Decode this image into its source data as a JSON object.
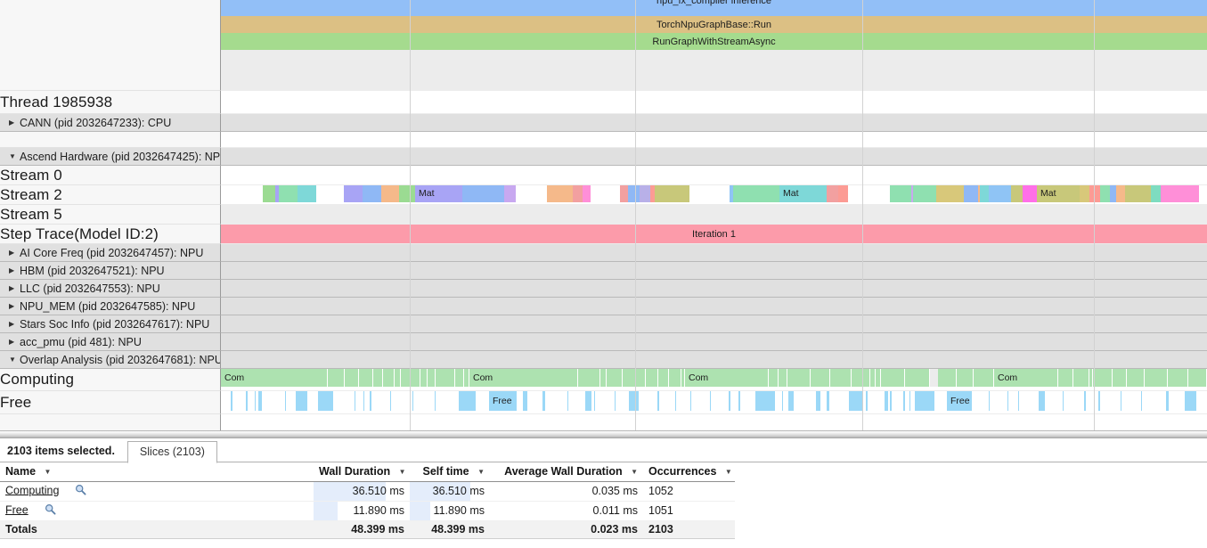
{
  "timeline": {
    "async_slices": [
      {
        "label": "npu_fx_compiler inference",
        "color": "#92BFF7",
        "textcolor": "#1d1d1d"
      },
      {
        "label": "TorchNpuGraphBase::Run",
        "color": "#DCC084",
        "textcolor": "#1d1d1d"
      },
      {
        "label": "RunGraphWithStreamAsync",
        "color": "#A5DB8E",
        "textcolor": "#1d1d1d"
      }
    ],
    "thread_label": "Thread 1985938",
    "groups": {
      "cann": "CANN (pid 2032647233): CPU",
      "ascend": "Ascend Hardware (pid 2032647425): NPU",
      "aicore": "AI Core Freq (pid 2032647457): NPU",
      "hbm": "HBM (pid 2032647521): NPU",
      "llc": "LLC (pid 2032647553): NPU",
      "npumem": "NPU_MEM (pid 2032647585): NPU",
      "stars": "Stars Soc Info (pid 2032647617): NPU",
      "accpmu": "acc_pmu (pid 481): NPU",
      "overlap": "Overlap Analysis (pid 2032647681): NPU"
    },
    "tracks": {
      "stream0": "Stream 0",
      "stream2": "Stream 2",
      "stream5": "Stream 5",
      "steptrace": "Step Trace(Model ID:2)",
      "computing": "Computing",
      "free": "Free"
    },
    "step_trace_slice": {
      "label": "Iteration 1",
      "color": "#FC9BAA"
    },
    "slice_labels": {
      "mat": "Mat",
      "com": "Com",
      "free": "Free"
    },
    "colors": {
      "computing": "#ADE2B0",
      "free": "#9BD8F7",
      "grid": "#d2d2d2",
      "group_bg": "#e0e0e0"
    },
    "gridlines": [
      460,
      713,
      968,
      1228
    ]
  },
  "details": {
    "selection_count_text": "2103 items selected.",
    "tab_label": "Slices (2103)",
    "columns": [
      {
        "key": "name",
        "label": "Name"
      },
      {
        "key": "wall",
        "label": "Wall Duration"
      },
      {
        "key": "self",
        "label": "Self time"
      },
      {
        "key": "avg",
        "label": "Average Wall Duration"
      },
      {
        "key": "occ",
        "label": "Occurrences"
      }
    ],
    "rows": [
      {
        "name": "Computing",
        "wall": "36.510 ms",
        "self": "36.510 ms",
        "avg": "0.035 ms",
        "occ": "1052",
        "wall_pct": 75,
        "self_pct": 75
      },
      {
        "name": "Free",
        "wall": "11.890 ms",
        "self": "11.890 ms",
        "avg": "0.011 ms",
        "occ": "1051",
        "wall_pct": 25,
        "self_pct": 25
      }
    ],
    "totals": {
      "name": "Totals",
      "wall": "48.399 ms",
      "self": "48.399 ms",
      "avg": "0.023 ms",
      "occ": "2103"
    }
  }
}
